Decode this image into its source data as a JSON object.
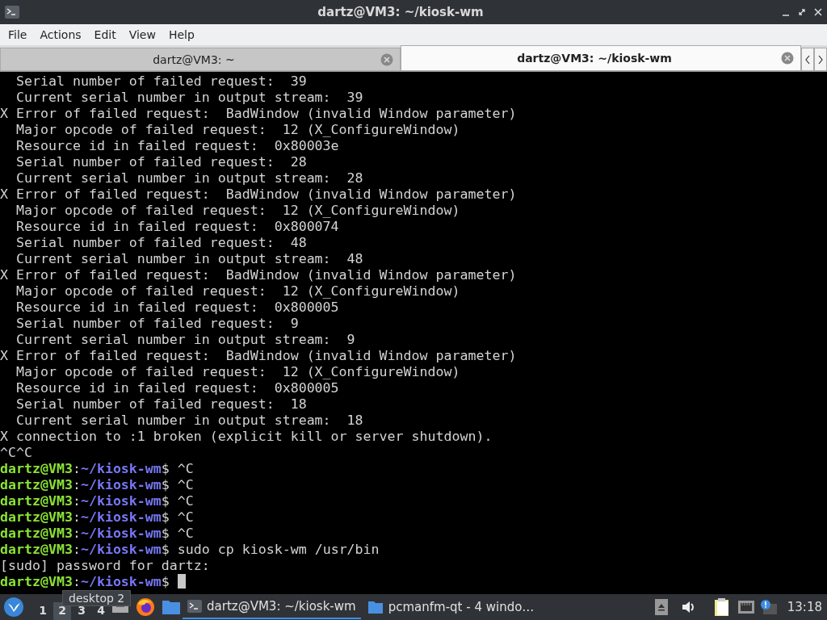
{
  "window": {
    "title": "dartz@VM3: ~/kiosk-wm"
  },
  "menu": [
    "File",
    "Actions",
    "Edit",
    "View",
    "Help"
  ],
  "tabs": [
    {
      "label": "dartz@VM3: ~",
      "selected": false
    },
    {
      "label": "dartz@VM3: ~/kiosk-wm",
      "selected": true
    }
  ],
  "terminal": {
    "lines": [
      {
        "kind": "output",
        "text": "  Serial number of failed request:  39"
      },
      {
        "kind": "output",
        "text": "  Current serial number in output stream:  39"
      },
      {
        "kind": "output",
        "text": "X Error of failed request:  BadWindow (invalid Window parameter)"
      },
      {
        "kind": "output",
        "text": "  Major opcode of failed request:  12 (X_ConfigureWindow)"
      },
      {
        "kind": "output",
        "text": "  Resource id in failed request:  0x80003e"
      },
      {
        "kind": "output",
        "text": "  Serial number of failed request:  28"
      },
      {
        "kind": "output",
        "text": "  Current serial number in output stream:  28"
      },
      {
        "kind": "output",
        "text": "X Error of failed request:  BadWindow (invalid Window parameter)"
      },
      {
        "kind": "output",
        "text": "  Major opcode of failed request:  12 (X_ConfigureWindow)"
      },
      {
        "kind": "output",
        "text": "  Resource id in failed request:  0x800074"
      },
      {
        "kind": "output",
        "text": "  Serial number of failed request:  48"
      },
      {
        "kind": "output",
        "text": "  Current serial number in output stream:  48"
      },
      {
        "kind": "output",
        "text": "X Error of failed request:  BadWindow (invalid Window parameter)"
      },
      {
        "kind": "output",
        "text": "  Major opcode of failed request:  12 (X_ConfigureWindow)"
      },
      {
        "kind": "output",
        "text": "  Resource id in failed request:  0x800005"
      },
      {
        "kind": "output",
        "text": "  Serial number of failed request:  9"
      },
      {
        "kind": "output",
        "text": "  Current serial number in output stream:  9"
      },
      {
        "kind": "output",
        "text": "X Error of failed request:  BadWindow (invalid Window parameter)"
      },
      {
        "kind": "output",
        "text": "  Major opcode of failed request:  12 (X_ConfigureWindow)"
      },
      {
        "kind": "output",
        "text": "  Resource id in failed request:  0x800005"
      },
      {
        "kind": "output",
        "text": "  Serial number of failed request:  18"
      },
      {
        "kind": "output",
        "text": "  Current serial number in output stream:  18"
      },
      {
        "kind": "output",
        "text": "X connection to :1 broken (explicit kill or server shutdown)."
      },
      {
        "kind": "output",
        "text": "^C^C"
      },
      {
        "kind": "prompt",
        "user": "dartz@VM3",
        "separator": ":",
        "path": "~/kiosk-wm",
        "symbol": "$",
        "command": "^C"
      },
      {
        "kind": "prompt",
        "user": "dartz@VM3",
        "separator": ":",
        "path": "~/kiosk-wm",
        "symbol": "$",
        "command": "^C"
      },
      {
        "kind": "prompt",
        "user": "dartz@VM3",
        "separator": ":",
        "path": "~/kiosk-wm",
        "symbol": "$",
        "command": "^C"
      },
      {
        "kind": "prompt",
        "user": "dartz@VM3",
        "separator": ":",
        "path": "~/kiosk-wm",
        "symbol": "$",
        "command": "^C"
      },
      {
        "kind": "prompt",
        "user": "dartz@VM3",
        "separator": ":",
        "path": "~/kiosk-wm",
        "symbol": "$",
        "command": "^C"
      },
      {
        "kind": "prompt",
        "user": "dartz@VM3",
        "separator": ":",
        "path": "~/kiosk-wm",
        "symbol": "$",
        "command": "sudo cp kiosk-wm /usr/bin"
      },
      {
        "kind": "output",
        "text": "[sudo] password for dartz:"
      },
      {
        "kind": "prompt",
        "user": "dartz@VM3",
        "separator": ":",
        "path": "~/kiosk-wm",
        "symbol": "$",
        "cursor": true
      }
    ]
  },
  "taskbar": {
    "desktops": [
      {
        "label": "1",
        "selected": false
      },
      {
        "label": "2",
        "selected": true
      },
      {
        "label": "3",
        "selected": false
      },
      {
        "label": "4",
        "selected": false
      }
    ],
    "tooltip": "desktop 2",
    "tasks": [
      {
        "label": "dartz@VM3: ~/kiosk-wm",
        "kind": "terminal",
        "selected": true
      },
      {
        "label": "pcmanfm-qt - 4 windo…",
        "kind": "folder",
        "selected": false
      }
    ],
    "clock": "13:18"
  }
}
